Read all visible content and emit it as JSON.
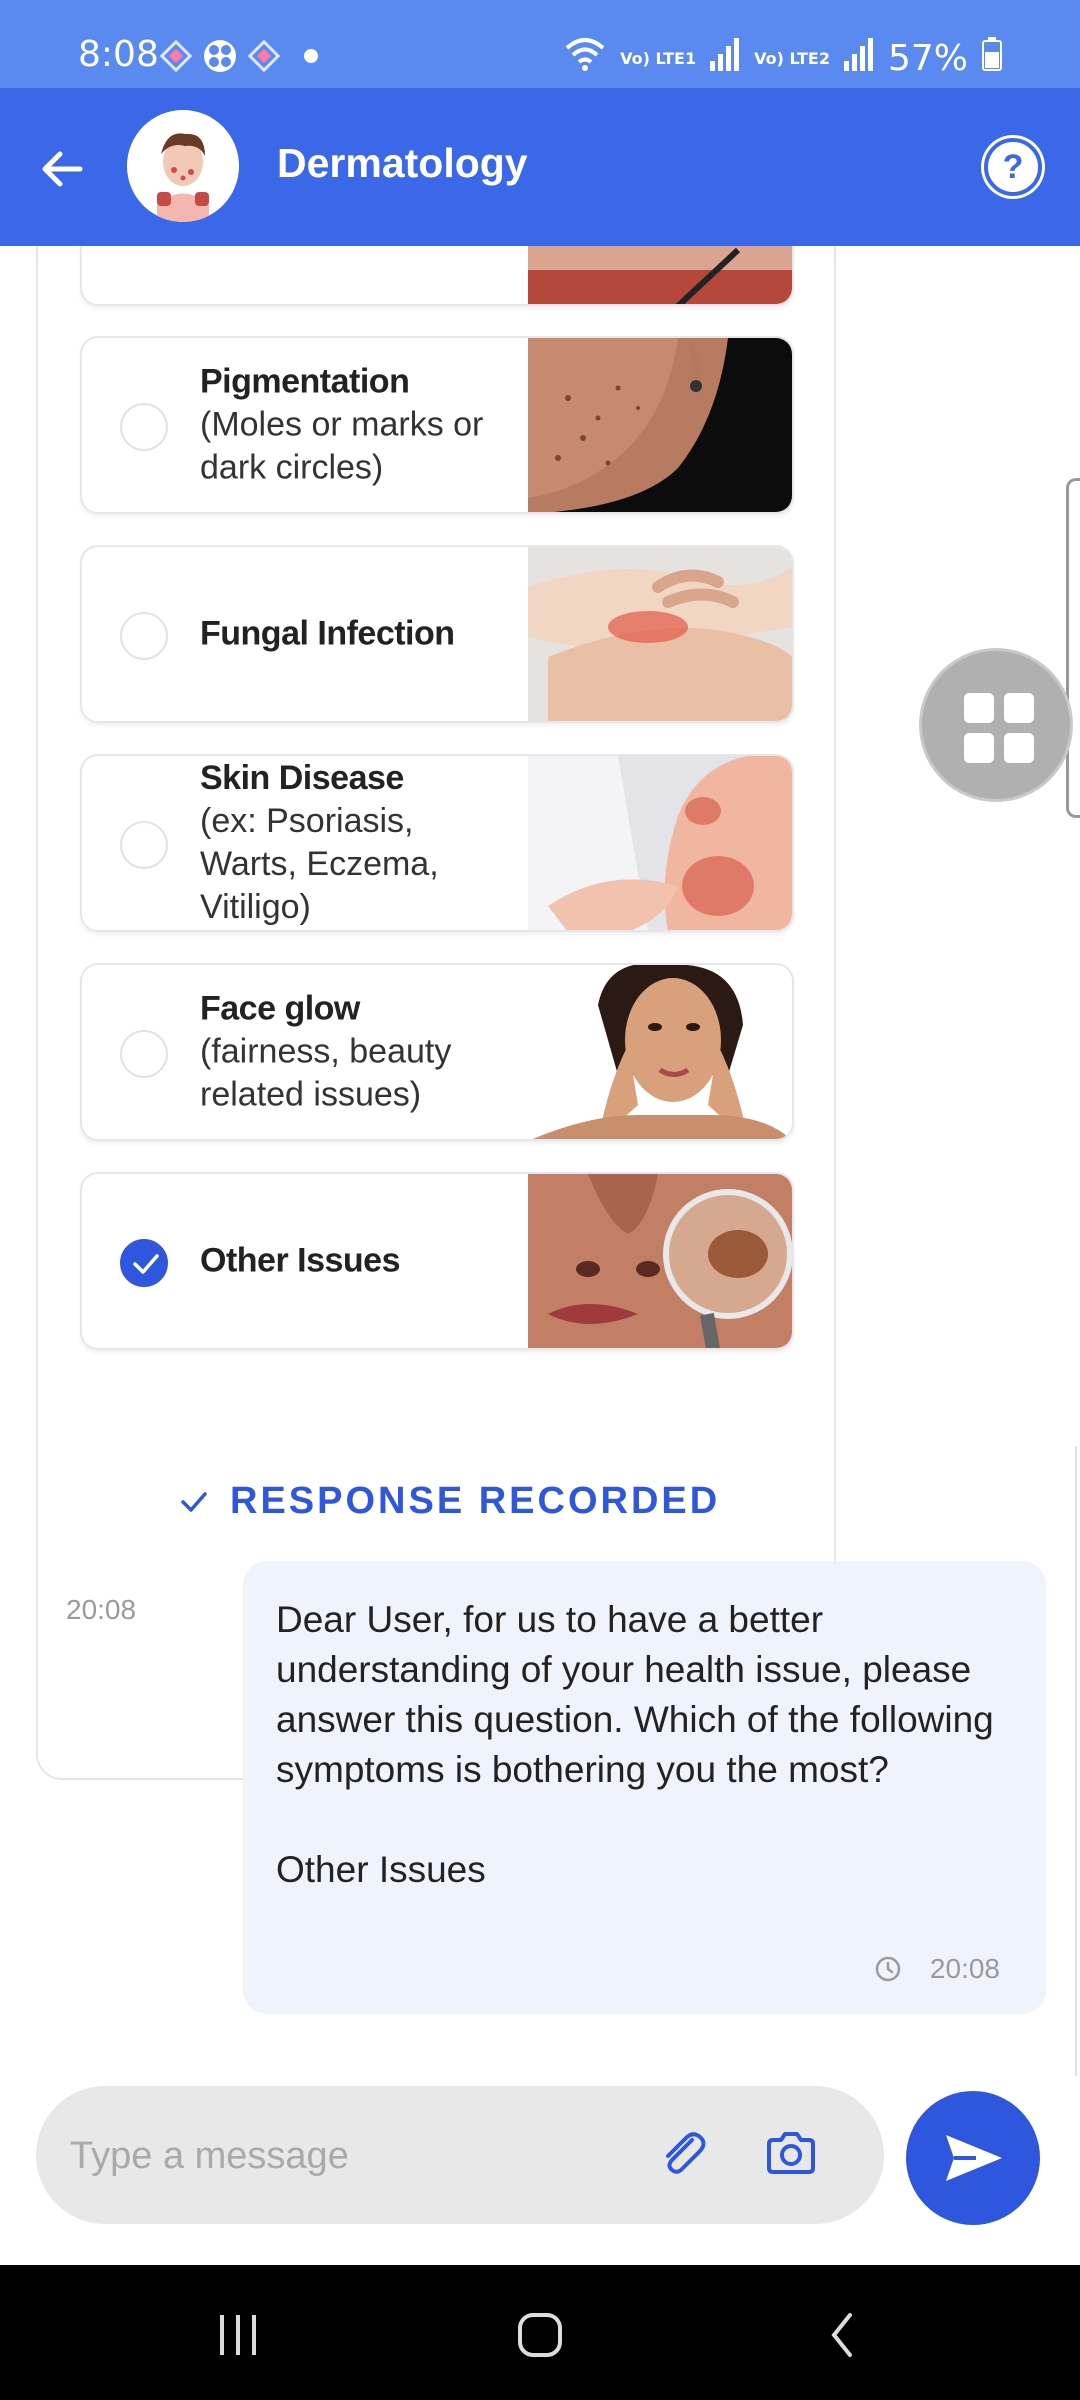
{
  "status_bar": {
    "time": "8:08",
    "battery": "57%",
    "network_1": "Vo) LTE1",
    "network_2": "Vo) LTE2"
  },
  "header": {
    "title": "Dermatology",
    "back_icon": "arrow-left-icon",
    "help_label": "?"
  },
  "options": [
    {
      "title": "Pigmentation",
      "subtitle": "(Moles or marks or dark circles)",
      "selected": false
    },
    {
      "title": "Fungal Infection",
      "subtitle": "",
      "selected": false
    },
    {
      "title": "Skin Disease",
      "subtitle": "(ex: Psoriasis, Warts, Eczema, Vitiligo)",
      "selected": false
    },
    {
      "title": "Face glow",
      "subtitle": "(fairness, beauty related issues)",
      "selected": false
    },
    {
      "title": "Other Issues",
      "subtitle": "",
      "selected": true
    }
  ],
  "bot_message": {
    "response_label": "RESPONSE RECORDED",
    "time": "20:08"
  },
  "user_message": {
    "text": "Dear User, for us to have a better understanding of your health issue, please answer this question. Which of the following symptoms is bothering you the most?",
    "answer": "Other Issues",
    "time": "20:08"
  },
  "composer": {
    "placeholder": "Type a message"
  },
  "colors": {
    "primary": "#3b68e8",
    "status_bar": "#5a8af0",
    "accent": "#2f57de",
    "user_bubble": "#eff3fc"
  }
}
